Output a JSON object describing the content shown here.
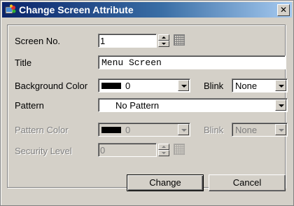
{
  "window": {
    "title": "Change Screen Attribute",
    "close_glyph": "✕",
    "icon": "screen-attribute-icon"
  },
  "form": {
    "screen_no": {
      "label": "Screen No.",
      "value": "1"
    },
    "title": {
      "label": "Title",
      "value": "Menu Screen"
    },
    "background_color": {
      "label": "Background Color",
      "value": "0",
      "swatch": "#000000"
    },
    "blink": {
      "label": "Blink",
      "value": "None"
    },
    "pattern": {
      "label": "Pattern",
      "value": "No Pattern"
    },
    "pattern_color": {
      "label": "Pattern Color",
      "value": "0",
      "swatch": "#000000"
    },
    "pattern_blink": {
      "label": "Blink",
      "value": "None"
    },
    "security_level": {
      "label": "Security Level",
      "value": "0"
    }
  },
  "buttons": {
    "change": "Change",
    "cancel": "Cancel"
  },
  "colors": {
    "titlebar_start": "#0a246a",
    "titlebar_end": "#a6caf0",
    "dialog_face": "#d4d0c8"
  }
}
